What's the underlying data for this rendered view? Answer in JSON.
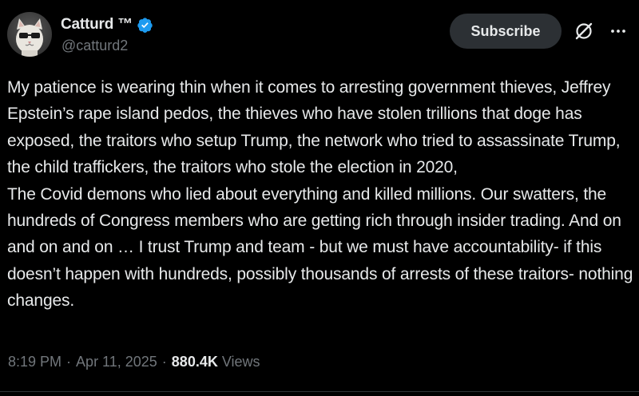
{
  "author": {
    "display_name": "Catturd ™",
    "handle": "@catturd2",
    "verified_color": "#1d9bf0"
  },
  "actions": {
    "subscribe_label": "Subscribe",
    "grok_icon": "grok-icon",
    "more_icon": "more-horizontal-icon"
  },
  "tweet": {
    "text": "My patience is wearing thin when it comes to arresting government thieves, Jeffrey Epstein’s rape island pedos, the thieves who have stolen trillions that doge has exposed, the traitors who setup Trump, the network who tried to assassinate Trump, the child traffickers, the traitors who stole the election in 2020,\nThe Covid demons who lied about everything and killed millions. Our swatters, the hundreds of Congress members who are getting rich through insider trading. And on and on and on … I trust Trump and team - but we must have accountability- if this doesn’t happen with hundreds, possibly thousands of arrests of these traitors- nothing changes."
  },
  "meta": {
    "time": "8:19 PM",
    "separator": "·",
    "date": "Apr 11, 2025",
    "views_count": "880.4K",
    "views_label": "Views"
  },
  "colors": {
    "background": "#000000",
    "text_primary": "#e7e9ea",
    "text_secondary": "#71767b",
    "button_bg": "#2c3034",
    "verified": "#1d9bf0"
  }
}
